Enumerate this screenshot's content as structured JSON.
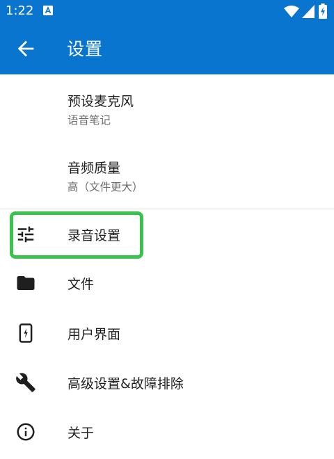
{
  "status_bar": {
    "time": "1:22",
    "icons": [
      "notification-icon",
      "wifi-icon",
      "signal-icon",
      "battery-charging-icon"
    ]
  },
  "app_bar": {
    "back_icon": "arrow-back-icon",
    "title": "设置"
  },
  "preferences": [
    {
      "title": "预设麦克风",
      "subtitle": "语音笔记"
    },
    {
      "title": "音频质量",
      "subtitle": "高（文件更大）"
    }
  ],
  "nav_items": [
    {
      "icon": "tune-icon",
      "label": "录音设置",
      "highlighted": true
    },
    {
      "icon": "folder-icon",
      "label": "文件"
    },
    {
      "icon": "phone-outline-icon",
      "label": "用户界面"
    },
    {
      "icon": "wrench-icon",
      "label": "高级设置&故障排除"
    },
    {
      "icon": "info-icon",
      "label": "关于"
    }
  ],
  "colors": {
    "primary": "#0a75cf",
    "highlight": "#3ac24e",
    "text_primary": "#1f1f1f",
    "text_secondary": "#6b6b6b"
  }
}
